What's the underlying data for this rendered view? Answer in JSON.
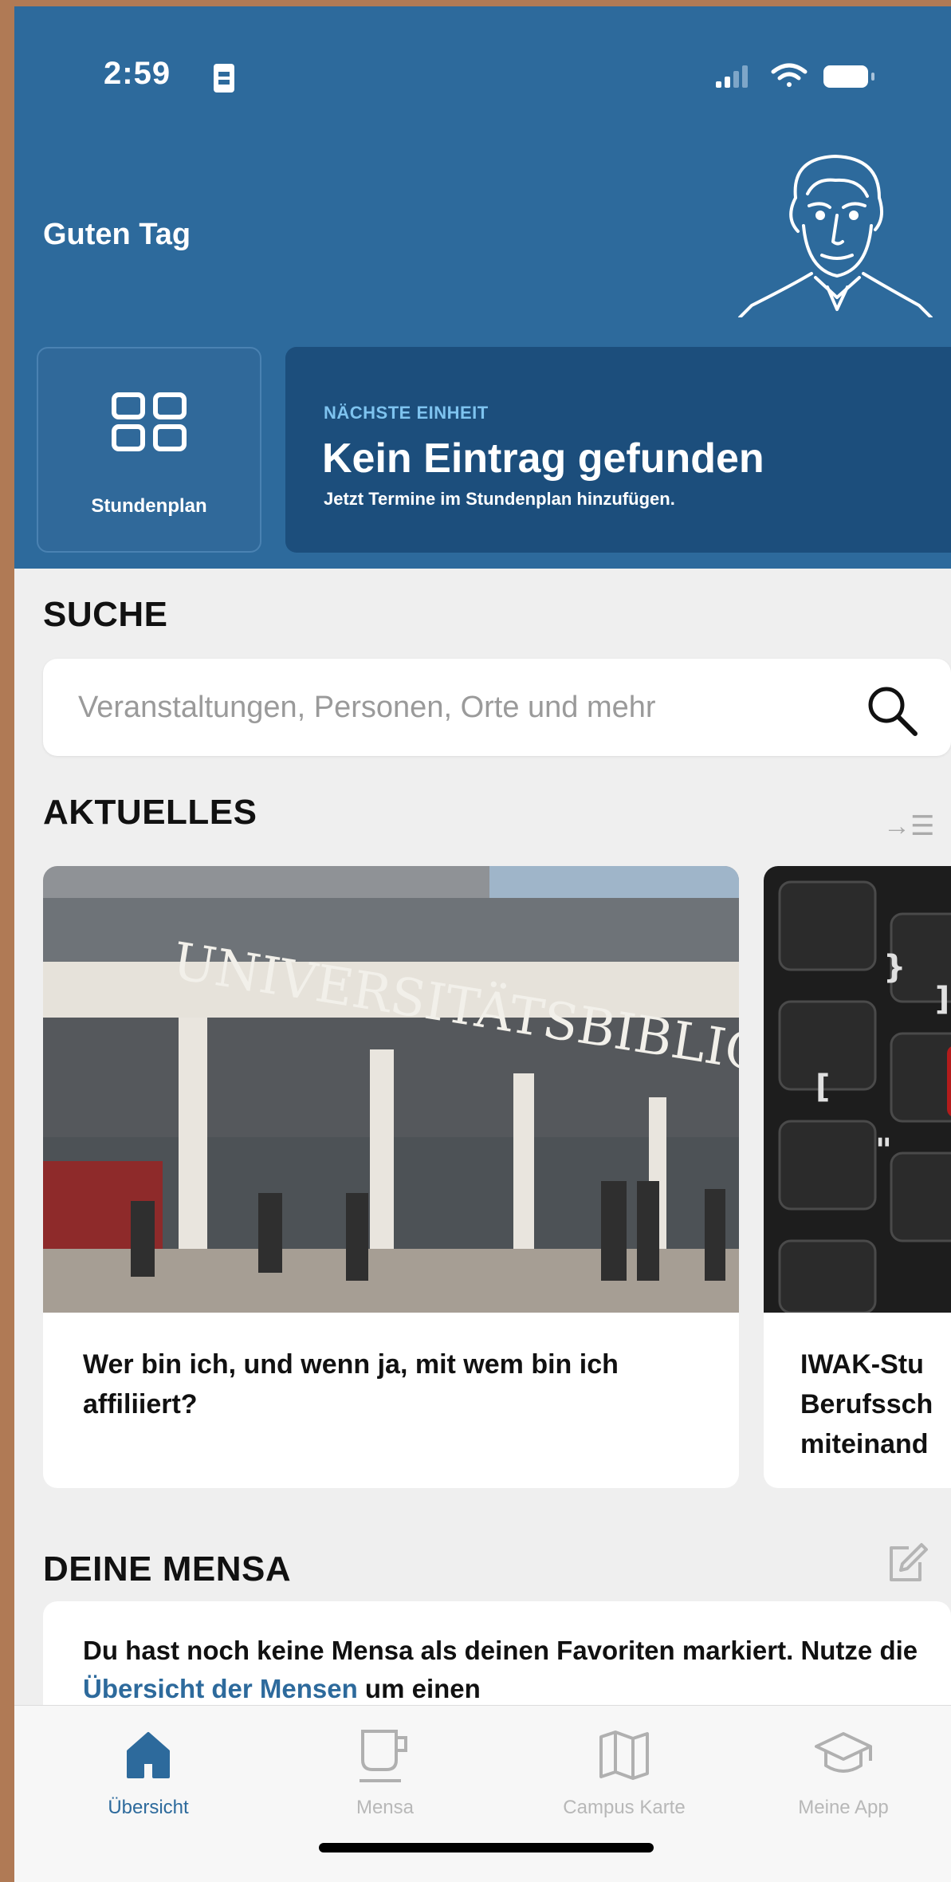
{
  "status_bar": {
    "time": "2:59"
  },
  "header": {
    "greeting": "Guten Tag",
    "stundenplan_label": "Stundenplan",
    "next_unit": {
      "kicker": "NÄCHSTE EINHEIT",
      "headline": "Kein Eintrag gefunden",
      "subtitle": "Jetzt Termine im Stundenplan hinzufügen."
    }
  },
  "search": {
    "title": "SUCHE",
    "placeholder": "Veranstaltungen, Personen, Orte und mehr"
  },
  "news": {
    "title": "AKTUELLES",
    "items": [
      {
        "title": "Wer bin ich, und wenn ja, mit wem bin ich affiliiert?",
        "sign_text": "UNIVERSITÄTSBIBLIOTHEK"
      },
      {
        "title": "IWAK-Stu\nBerufssch\nmiteinand"
      }
    ]
  },
  "mensa": {
    "title": "DEINE MENSA",
    "text_before": "Du hast noch keine Mensa als deinen Favoriten markiert. Nutze die ",
    "link": "Übersicht der Mensen",
    "text_after": " um einen"
  },
  "tabbar": {
    "items": [
      {
        "label": "Übersicht",
        "icon": "home-icon",
        "active": true
      },
      {
        "label": "Mensa",
        "icon": "cup-icon",
        "active": false
      },
      {
        "label": "Campus Karte",
        "icon": "map-icon",
        "active": false
      },
      {
        "label": "Meine App",
        "icon": "graduation-cap-icon",
        "active": false
      }
    ]
  },
  "colors": {
    "header_blue": "#2d6a9c",
    "next_unit_blue": "#1c4e7c",
    "accent": "#7ec3ef",
    "background": "#efefef"
  }
}
